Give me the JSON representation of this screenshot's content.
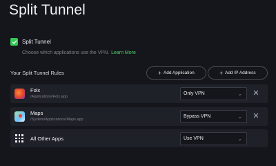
{
  "page": {
    "title": "Split Tunnel"
  },
  "toggle": {
    "label": "Split Tunnel",
    "checked": true
  },
  "description": {
    "text": "Choose which applications use the VPN.",
    "link": "Learn More"
  },
  "rules": {
    "title": "Your Split Tunnel Rules",
    "add_app_label": "Add Application",
    "add_ip_label": "Add IP Address",
    "items": [
      {
        "name": "Folx",
        "path": "/Applications/Folx.app",
        "mode": "Only VPN"
      },
      {
        "name": "Maps",
        "path": "/System/Applications/Maps.app",
        "mode": "Bypass VPN"
      },
      {
        "name": "All Other Apps",
        "path": "",
        "mode": "Use VPN"
      }
    ]
  },
  "colors": {
    "accent": "#34c759",
    "link": "#4fd06b",
    "background": "#15161b",
    "row": "#1f2128"
  },
  "icons": [
    "check-icon",
    "plus-icon",
    "folx-app-icon",
    "maps-app-icon",
    "apps-grid-icon",
    "chevron-down-icon",
    "close-icon"
  ]
}
